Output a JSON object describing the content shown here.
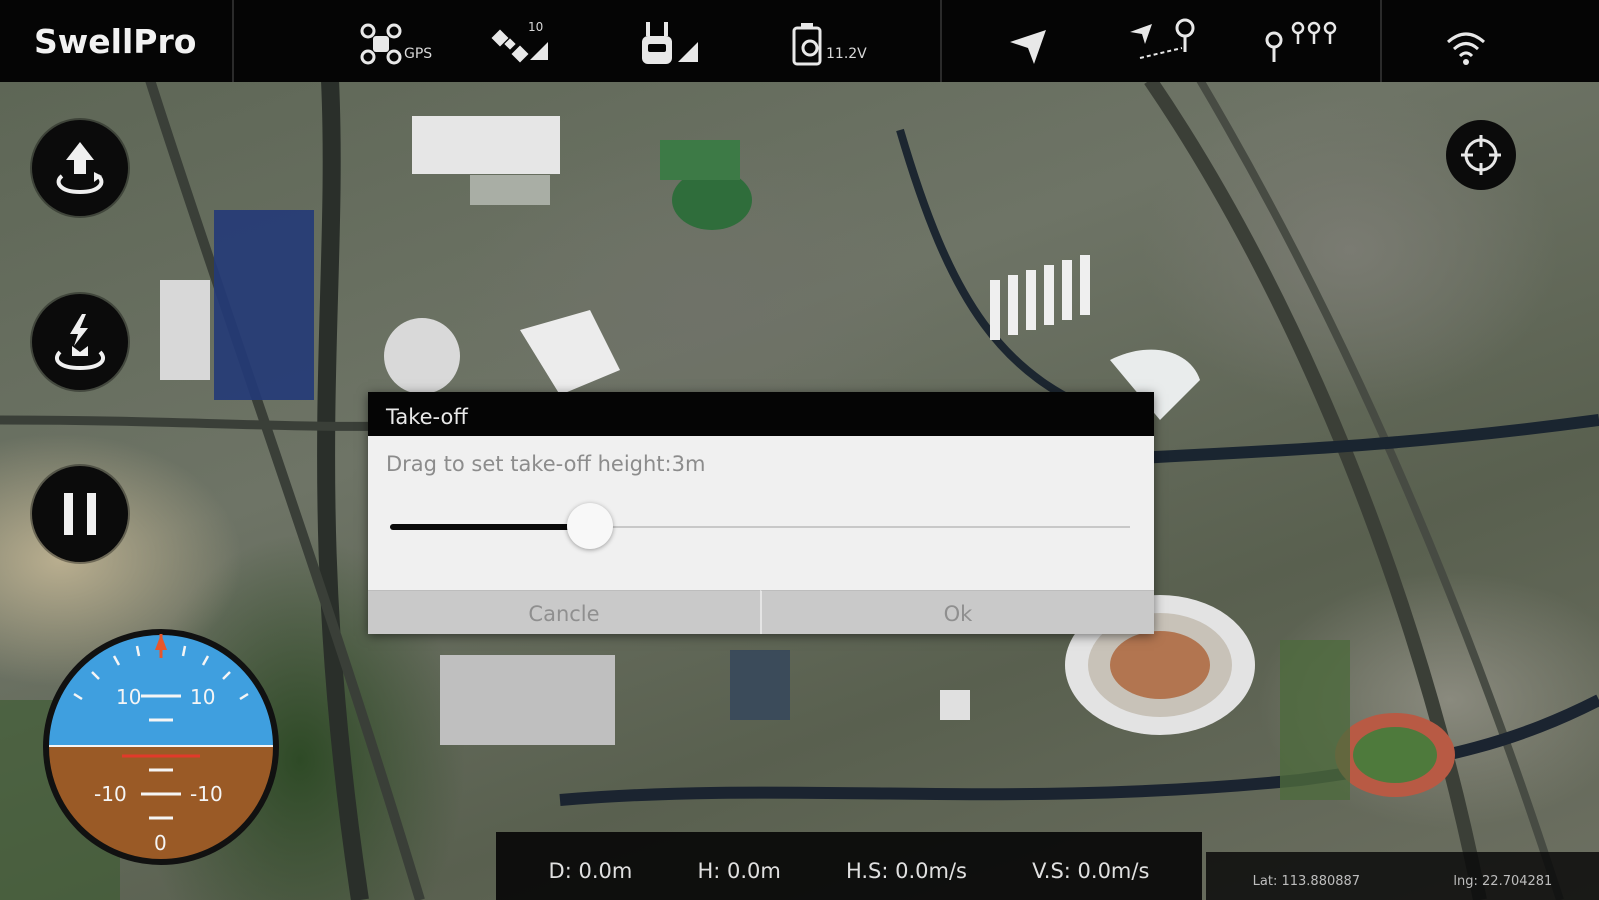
{
  "app": {
    "logo": "SwellPro"
  },
  "topbar": {
    "items": [
      {
        "name": "drone-icon",
        "label": "GPS"
      },
      {
        "name": "satellite-icon",
        "label": "10"
      },
      {
        "name": "remote-controller-icon",
        "label": ""
      },
      {
        "name": "battery-icon",
        "label": "11.2V"
      },
      {
        "name": "send-icon",
        "label": ""
      },
      {
        "name": "waypoint-route-icon",
        "label": ""
      },
      {
        "name": "multi-waypoint-icon",
        "label": ""
      },
      {
        "name": "wifi-icon",
        "label": ""
      }
    ]
  },
  "controls": {
    "left_buttons": [
      {
        "name": "takeoff-icon"
      },
      {
        "name": "return-home-icon"
      },
      {
        "name": "pause-icon"
      }
    ],
    "right_button": {
      "name": "locate-crosshair-icon"
    }
  },
  "attitude": {
    "labels_top": [
      "10",
      "10"
    ],
    "labels_bottom": [
      "-10",
      "-10"
    ],
    "zero": "0",
    "sky_color": "#3f9fdf",
    "ground_color": "#9a5a26",
    "pointer_color": "#e8562a"
  },
  "dialog": {
    "title": "Take-off",
    "message": "Drag to set take-off height:3m",
    "slider_fraction": 0.27,
    "cancel_label": "Cancle",
    "ok_label": "Ok"
  },
  "telemetry": {
    "d": "D: 0.0m",
    "h": "H: 0.0m",
    "hs": "H.S: 0.0m/s",
    "vs": "V.S: 0.0m/s"
  },
  "coords": {
    "lat": "Lat: 113.880887",
    "lng": "lng: 22.704281"
  }
}
